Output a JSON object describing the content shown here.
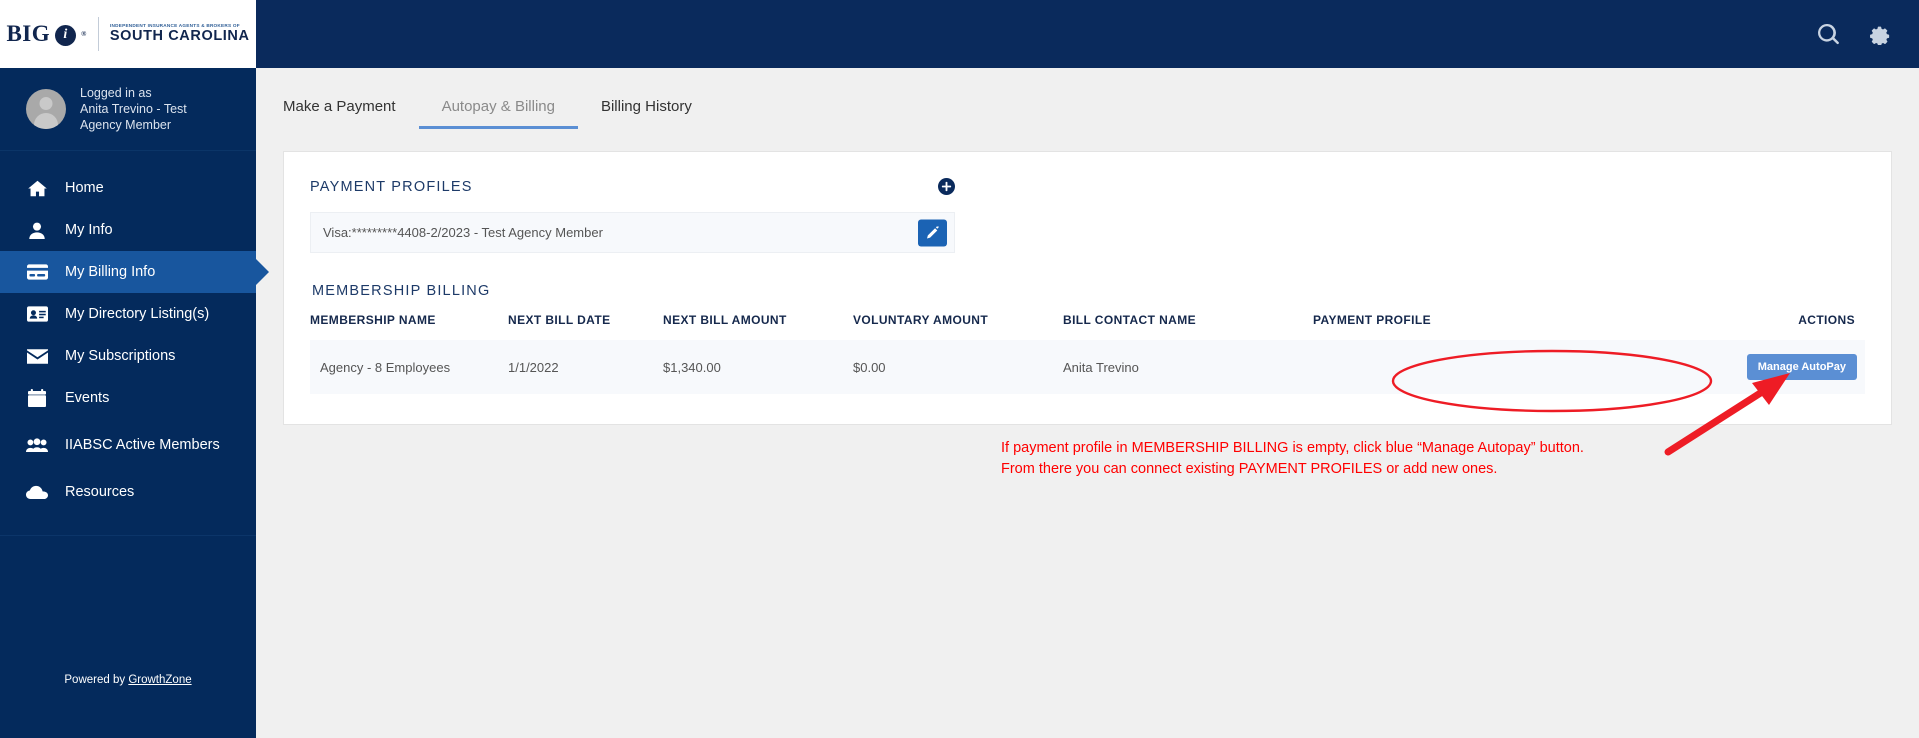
{
  "brand": {
    "logo_primary": "BIG",
    "logo_mark": "i",
    "logo_registered": "®",
    "logo_tagline": "INDEPENDENT INSURANCE AGENTS & BROKERS OF",
    "logo_state": "SOUTH CAROLINA"
  },
  "topbar": {
    "search_icon": "search-icon",
    "settings_icon": "gear-icon"
  },
  "user": {
    "logged_in_label": "Logged in as",
    "name_line": "Anita Trevino - Test",
    "role_line": "Agency Member"
  },
  "sidebar": {
    "items": [
      {
        "label": "Home",
        "icon": "home-icon",
        "active": false
      },
      {
        "label": "My Info",
        "icon": "user-icon",
        "active": false
      },
      {
        "label": "My Billing Info",
        "icon": "credit-card-icon",
        "active": true
      },
      {
        "label": "My Directory Listing(s)",
        "icon": "id-card-icon",
        "active": false
      },
      {
        "label": "My Subscriptions",
        "icon": "envelope-icon",
        "active": false
      },
      {
        "label": "Events",
        "icon": "calendar-icon",
        "active": false
      },
      {
        "label": "IIABSC Active Members",
        "icon": "users-icon",
        "active": false
      },
      {
        "label": "Resources",
        "icon": "cloud-icon",
        "active": false
      }
    ],
    "powered_by_prefix": "Powered by",
    "powered_by_link": "GrowthZone"
  },
  "tabs": [
    {
      "label": "Make a Payment",
      "active": false
    },
    {
      "label": "Autopay & Billing",
      "active": true
    },
    {
      "label": "Billing History",
      "active": false
    }
  ],
  "payment_profiles": {
    "title": "PAYMENT PROFILES",
    "add_icon": "plus-circle-icon",
    "rows": [
      {
        "text": "Visa:*********4408-2/2023 - Test Agency Member",
        "edit_icon": "pencil-icon"
      }
    ]
  },
  "membership_billing": {
    "title": "MEMBERSHIP BILLING",
    "columns": [
      "MEMBERSHIP NAME",
      "NEXT BILL DATE",
      "NEXT BILL AMOUNT",
      "VOLUNTARY AMOUNT",
      "BILL CONTACT NAME",
      "PAYMENT PROFILE",
      "ACTIONS"
    ],
    "rows": [
      {
        "membership_name": "Agency - 8 Employees",
        "next_bill_date": "1/1/2022",
        "next_bill_amount": "$1,340.00",
        "voluntary_amount": "$0.00",
        "bill_contact_name": "Anita Trevino",
        "payment_profile": "",
        "action_label": "Manage AutoPay"
      }
    ]
  },
  "annotation": {
    "line1": "If payment profile in MEMBERSHIP BILLING is empty, click blue “Manage Autopay” button.",
    "line2": "From there you can connect existing PAYMENT PROFILES or add new ones.",
    "color": "#ff0000"
  },
  "colors": {
    "sidebar_bg": "#042a5c",
    "topbar_bg": "#0a2a5c",
    "active_nav": "#18569e",
    "accent_button": "#5b8fd4",
    "edit_button": "#1b63b4",
    "annotation": "#ff0000"
  }
}
